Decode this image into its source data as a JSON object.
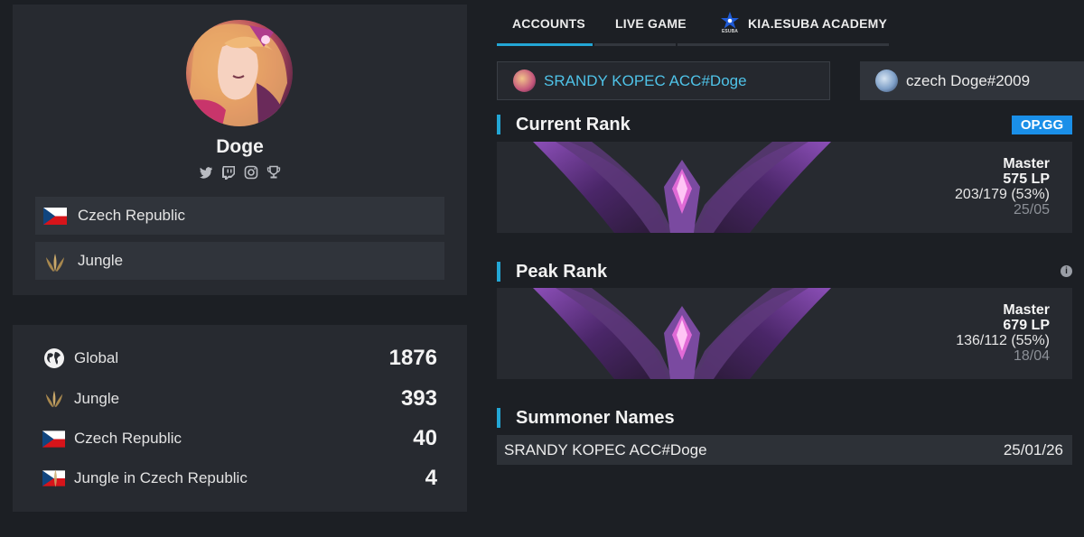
{
  "profile": {
    "name": "Doge",
    "socials": [
      "twitter-icon",
      "twitch-icon",
      "instagram-icon",
      "trophy-icon"
    ],
    "country": "Czech Republic",
    "role": "Jungle"
  },
  "rankings": [
    {
      "icon": "globe-icon",
      "label": "Global",
      "value": "1876"
    },
    {
      "icon": "jungle-icon",
      "label": "Jungle",
      "value": "393"
    },
    {
      "icon": "czech-flag-icon",
      "label": "Czech Republic",
      "value": "40"
    },
    {
      "icon": "jungle-czech-icon",
      "label": "Jungle in Czech Republic",
      "value": "4"
    }
  ],
  "tabs": [
    {
      "label": "ACCOUNTS",
      "active": true
    },
    {
      "label": "LIVE GAME",
      "active": false
    },
    {
      "label": "KIA.ESUBA ACADEMY",
      "active": false
    }
  ],
  "team_logo_text": "ESUBA",
  "accounts": [
    {
      "name": "SRANDY KOPEC ACC#Doge",
      "selected": true
    },
    {
      "name": "czech Doge#2009",
      "selected": false
    }
  ],
  "current_rank": {
    "title": "Current Rank",
    "badge": "OP.GG",
    "tier": "Master",
    "lp": "575 LP",
    "winloss": "203/179 (53%)",
    "date": "25/05"
  },
  "peak_rank": {
    "title": "Peak Rank",
    "info": "i",
    "tier": "Master",
    "lp": "679 LP",
    "winloss": "136/112 (55%)",
    "date": "18/04"
  },
  "summoner_names": {
    "title": "Summoner Names",
    "rows": [
      {
        "name": "SRANDY KOPEC ACC#Doge",
        "date": "25/01/26"
      }
    ]
  },
  "colors": {
    "accent": "#23a6d5",
    "opgg": "#1a8fe8",
    "link": "#4fc3e8",
    "background": "#1c1f24",
    "card": "#272a30"
  }
}
